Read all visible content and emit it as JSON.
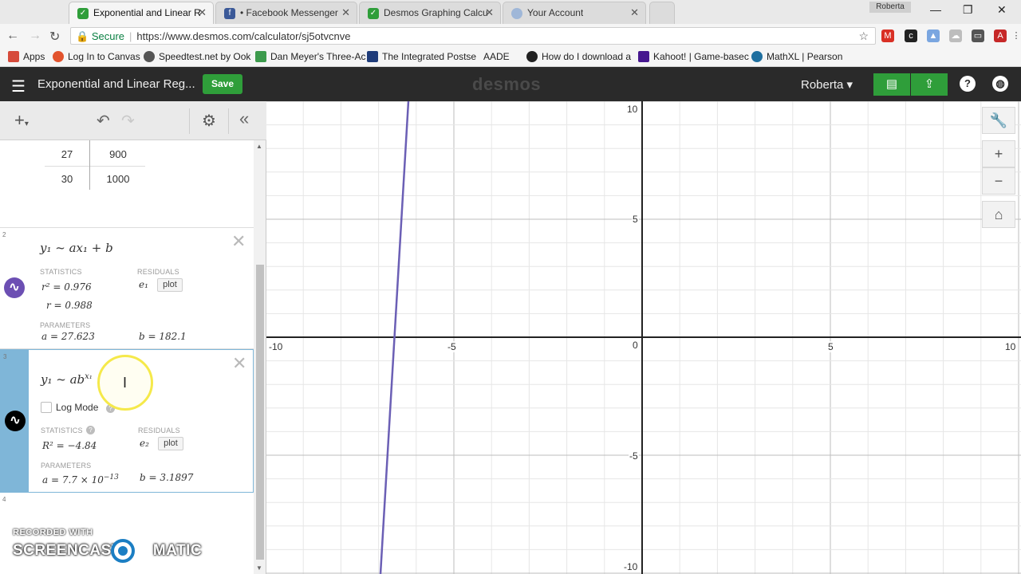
{
  "browser": {
    "tabs": [
      {
        "label": "Exponential and Linear R",
        "active": true,
        "fav_color": "#2f9e3a"
      },
      {
        "label": "• Facebook Messenger",
        "active": false,
        "fav_color": "#3b5998"
      },
      {
        "label": "Desmos Graphing Calcu",
        "active": false,
        "fav_color": "#2f9e3a"
      },
      {
        "label": "Your Account",
        "active": false,
        "fav_color": "#9fb7d8"
      }
    ],
    "user_chip": "Roberta",
    "secure_label": "Secure",
    "url": "https://www.desmos.com/calculator/sj5otvcnve",
    "bookmarks": [
      {
        "label": "Apps",
        "color": "#d64b3b"
      },
      {
        "label": "Log In to Canvas",
        "color": "#e2532d"
      },
      {
        "label": "Speedtest.net by Ook",
        "color": "#555555"
      },
      {
        "label": "Dan Meyer's Three-Ac",
        "color": "#3c9a4c"
      },
      {
        "label": "The Integrated Postse",
        "color": "#1f3c7a"
      },
      {
        "label": "AADE",
        "color": "#f5f5f5"
      },
      {
        "label": "How do I download a",
        "color": "#222222"
      },
      {
        "label": "Kahoot! | Game-basec",
        "color": "#46178f"
      },
      {
        "label": "MathXL | Pearson",
        "color": "#1f6f9f"
      }
    ]
  },
  "desmos": {
    "graph_title": "Exponential and Linear Reg...",
    "save_label": "Save",
    "brand": "desmos",
    "user_name": "Roberta"
  },
  "table": {
    "rows": [
      [
        "27",
        "900"
      ],
      [
        "30",
        "1000"
      ]
    ]
  },
  "expressions": [
    {
      "index": "2",
      "formula": "y₁ ~ ax₁ + b",
      "statistics_label": "STATISTICS",
      "residuals_label": "RESIDUALS",
      "r2": "r² = 0.976",
      "r": "r = 0.988",
      "residual_var": "e₁",
      "plot_label": "plot",
      "parameters_label": "PARAMETERS",
      "a": "a = 27.623",
      "b": "b = 182.1",
      "color": "#6c4fb3"
    },
    {
      "index": "3",
      "formula_base": "y₁ ~ ab",
      "formula_exp": "x₁",
      "log_mode_label": "Log Mode",
      "statistics_label": "STATISTICS",
      "residuals_label": "RESIDUALS",
      "r2": "R² = −4.84",
      "residual_var": "e₂",
      "plot_label": "plot",
      "parameters_label": "PARAMETERS",
      "a_base": "a = 7.7 × 10",
      "a_exp": "−13",
      "b": "b = 3.1897",
      "color": "#000000"
    }
  ],
  "next_index": "4",
  "graph": {
    "x_ticks": [
      "-10",
      "-5",
      "0",
      "5",
      "10"
    ],
    "y_ticks": [
      "10",
      "5",
      "-5",
      "-10"
    ],
    "curve_color": "#6b5fb5"
  },
  "watermark": {
    "line1": "RECORDED WITH",
    "line2a": "SCREENCAST",
    "line2b": "MATIC"
  },
  "icons": {
    "back": "back-arrow-icon",
    "wrench": "wrench-icon",
    "home": "home-icon"
  }
}
